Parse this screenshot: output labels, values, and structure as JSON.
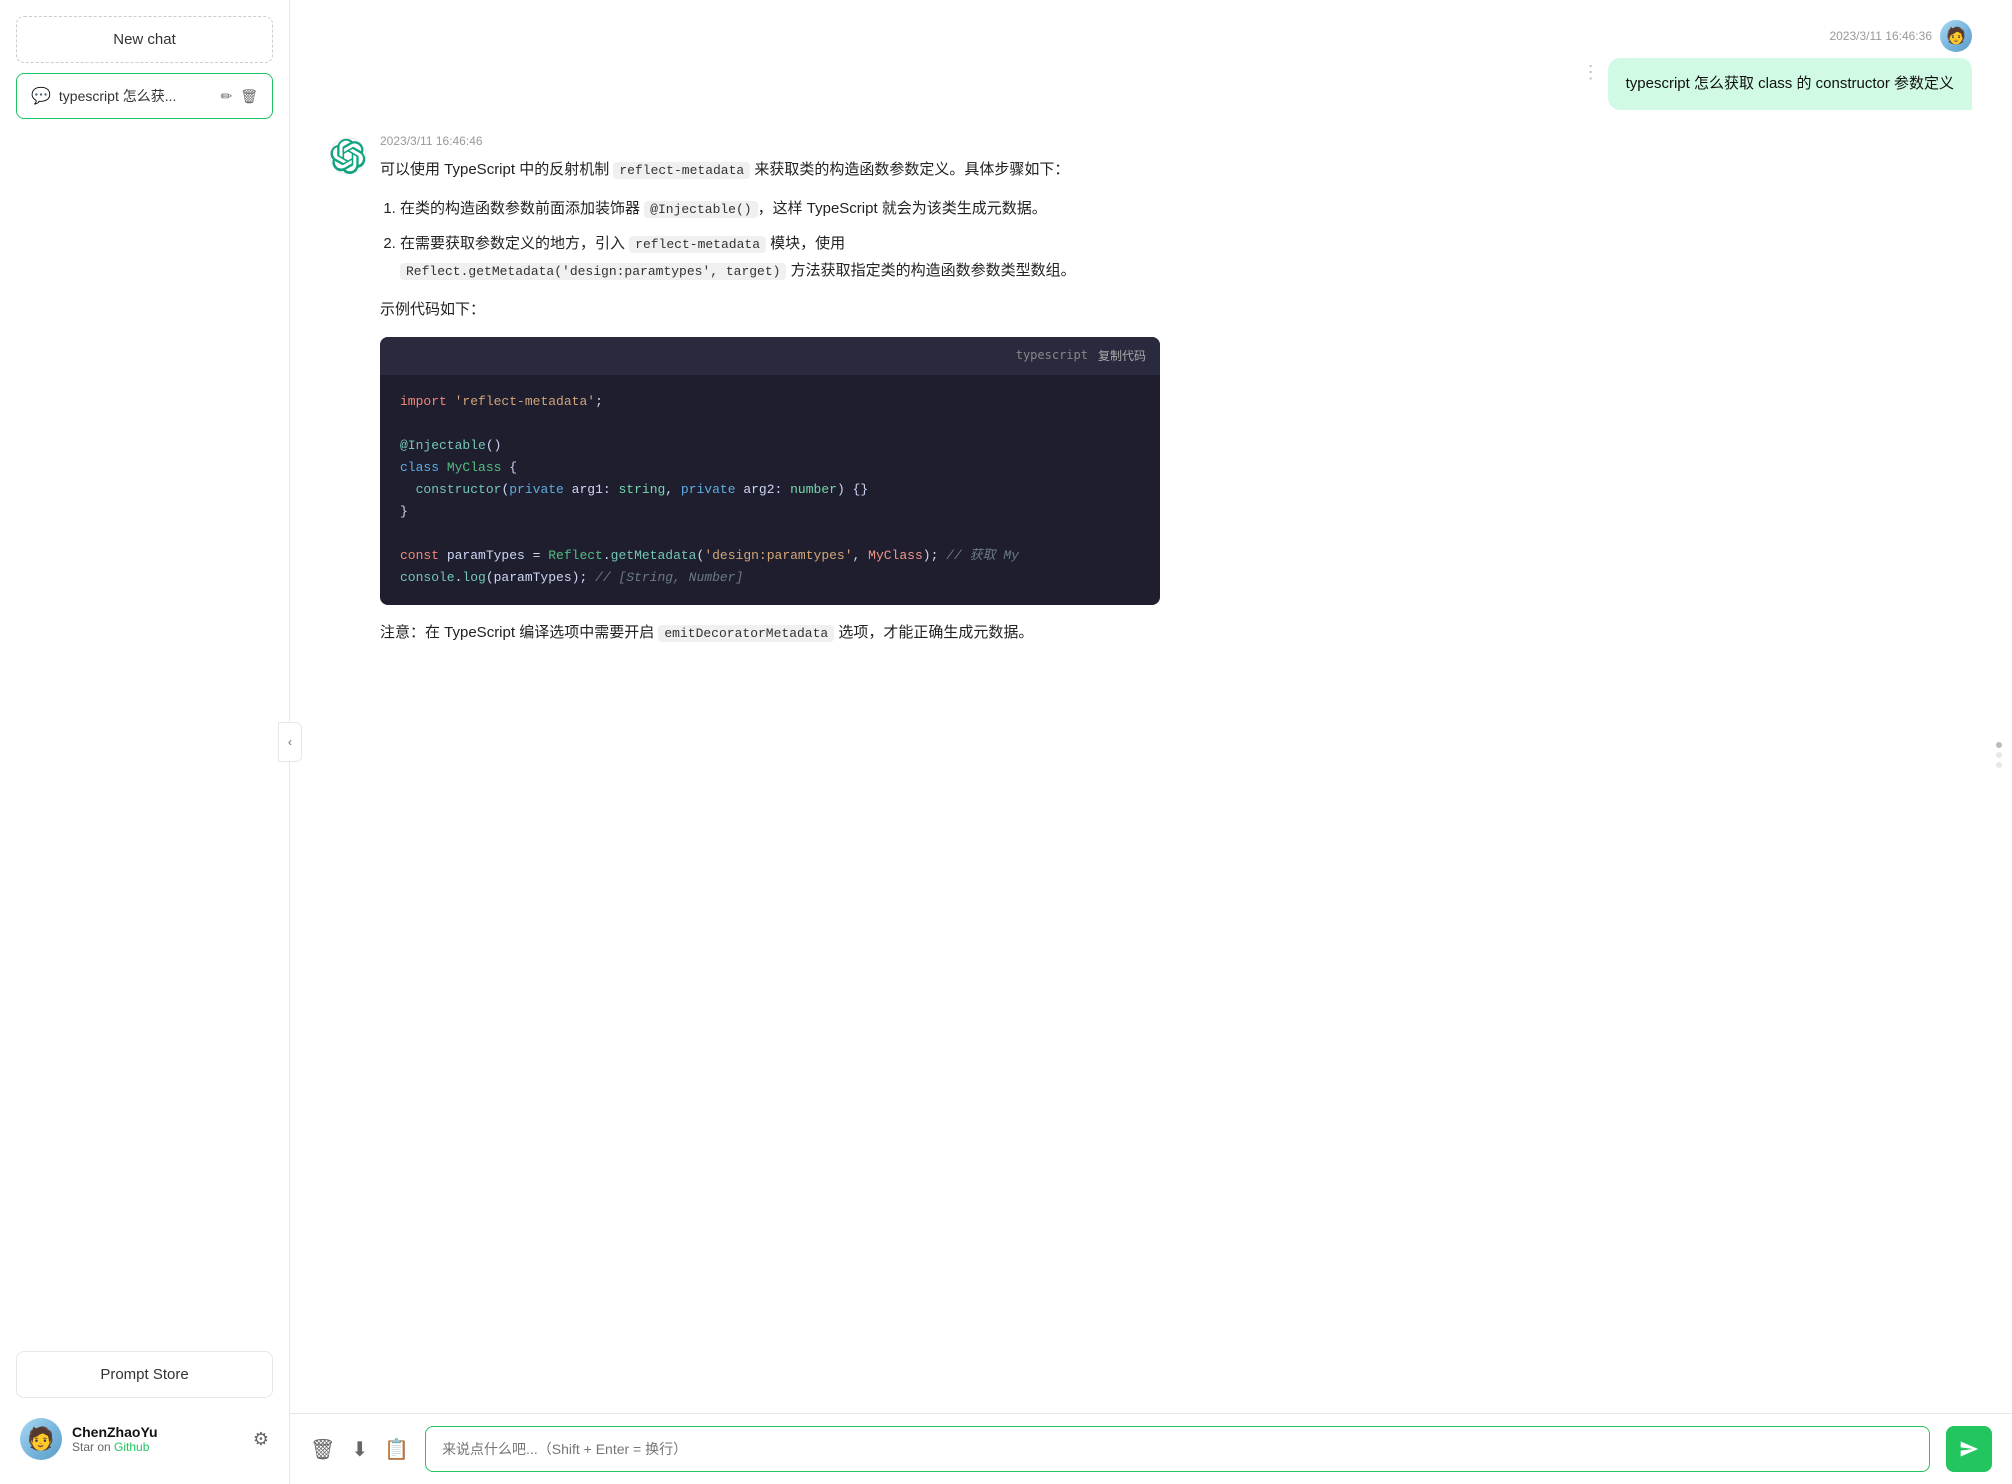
{
  "sidebar": {
    "new_chat_label": "New chat",
    "chat_item": {
      "title": "typescript 怎么获...",
      "icon": "💬",
      "edit_icon": "✏",
      "delete_icon": "🗑"
    },
    "prompt_store_label": "Prompt Store",
    "user": {
      "name": "ChenZhaoYu",
      "sub_text": "Star on ",
      "sub_link": "Github",
      "avatar_emoji": "🧑"
    }
  },
  "header": {
    "timestamp": "2023/3/11 16:46:36"
  },
  "user_message": {
    "text": "typescript 怎么获取 class 的 constructor 参数定义"
  },
  "ai_response": {
    "timestamp": "2023/3/11 16:46:46",
    "intro": "可以使用 TypeScript 中的反射机制 reflect-metadata 来获取类的构造函数参数定义。具体步骤如下：",
    "steps": [
      "在类的构造函数参数前面添加装饰器 @Injectable()，这样 TypeScript 就会为该类生成元数据。",
      "在需要获取参数定义的地方，引入 reflect-metadata 模块，使用 Reflect.getMetadata('design:paramtypes', target) 方法获取指定类的构造函数参数类型数组。"
    ],
    "example_label": "示例代码如下：",
    "code": {
      "lang": "typescript",
      "copy_label": "复制代码",
      "lines": [
        {
          "type": "import",
          "text": "import 'reflect-metadata';"
        },
        {
          "type": "blank"
        },
        {
          "type": "decorator",
          "text": "@Injectable()"
        },
        {
          "type": "class_def",
          "text": "class MyClass {"
        },
        {
          "type": "constructor",
          "text": "  constructor(private arg1: string, private arg2: number) {}"
        },
        {
          "type": "close",
          "text": "}"
        },
        {
          "type": "blank"
        },
        {
          "type": "const_line",
          "text": "const paramTypes = Reflect.getMetadata('design:paramtypes', MyClass); // 获取 My"
        },
        {
          "type": "console_line",
          "text": "console.log(paramTypes); // [String, Number]"
        }
      ]
    },
    "note": "注意：在 TypeScript 编译选项中需要开启 emitDecoratorMetadata 选项，才能正确生成元数据。"
  },
  "input": {
    "placeholder": "来说点什么吧...（Shift + Enter = 换行）"
  },
  "icons": {
    "settings": "⚙",
    "collapse": "‹",
    "trash": "🗑",
    "download": "⬇",
    "share": "📋",
    "send": "➤",
    "more": "⋮"
  }
}
